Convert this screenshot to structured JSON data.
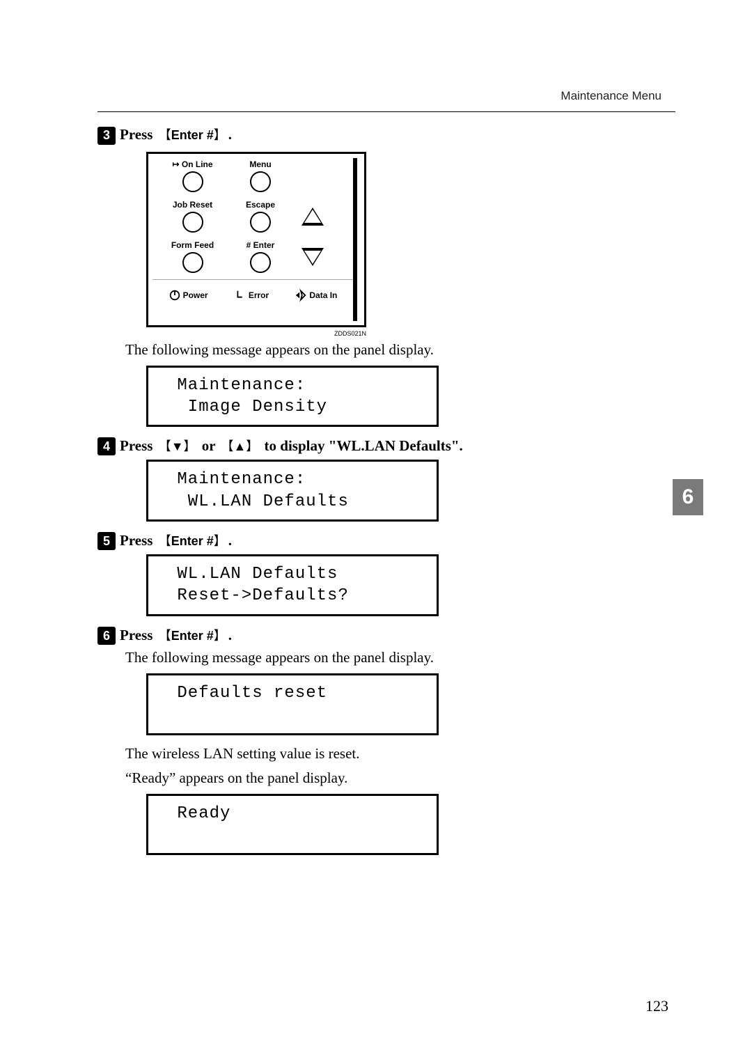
{
  "header": {
    "section_title": "Maintenance Menu"
  },
  "panel_diagram": {
    "labels": {
      "online": "On Line",
      "menu": "Menu",
      "jobreset": "Job Reset",
      "escape": "Escape",
      "formfeed": "Form Feed",
      "enter": "Enter",
      "power": "Power",
      "error": "Error",
      "datain": "Data In"
    },
    "ref": "ZDDS021N"
  },
  "steps": {
    "s3": {
      "prefix": "Press ",
      "key": "Enter #",
      "suffix": ".",
      "after_text": "The following message appears on the panel display.",
      "lcd": " Maintenance:\n  Image Density"
    },
    "s4": {
      "prefix": "Press ",
      "key1": "▼",
      "mid": " or ",
      "key2": "▲",
      "suffix": " to display \"WL.LAN Defaults\".",
      "lcd": " Maintenance:\n  WL.LAN Defaults"
    },
    "s5": {
      "prefix": "Press ",
      "key": "Enter #",
      "suffix": ".",
      "lcd": " WL.LAN Defaults\n Reset->Defaults?"
    },
    "s6": {
      "prefix": "Press ",
      "key": "Enter #",
      "suffix": ".",
      "after_text1": "The following message appears on the panel display.",
      "lcd1": " Defaults reset\n ",
      "after_text2": "The wireless LAN setting value is reset.",
      "after_text3": "“Ready” appears on the panel display.",
      "lcd2": " Ready\n "
    }
  },
  "chapter_tab": "6",
  "page_number": "123"
}
